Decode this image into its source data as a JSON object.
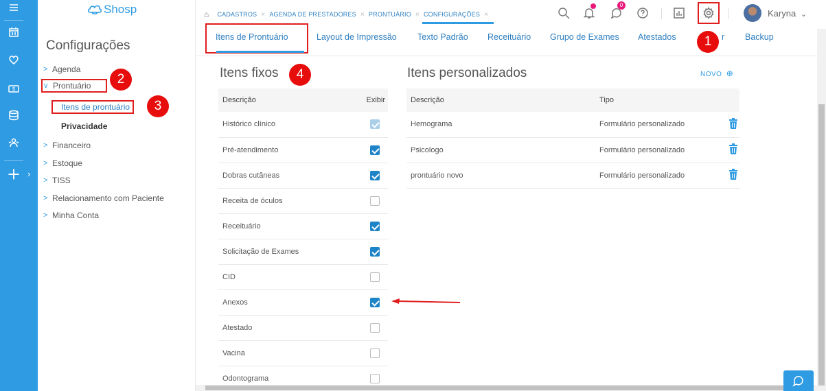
{
  "app": {
    "logo_text": "Shosp"
  },
  "rail": {
    "icons": [
      "menu-icon",
      "calendar-icon",
      "heart-icon",
      "money-icon",
      "database-icon",
      "users-icon",
      "plus-icon"
    ],
    "expand_glyph": "›"
  },
  "sidebar": {
    "title": "Configurações",
    "items": [
      {
        "label": "Agenda",
        "chevron": ">"
      },
      {
        "label": "Prontuário",
        "chevron": "v",
        "expanded": true
      },
      {
        "label": "Financeiro",
        "chevron": ">"
      },
      {
        "label": "Estoque",
        "chevron": ">"
      },
      {
        "label": "TISS",
        "chevron": ">"
      },
      {
        "label": "Relacionamento com Paciente",
        "chevron": ">"
      },
      {
        "label": "Minha Conta",
        "chevron": ">"
      }
    ],
    "sub_items": [
      {
        "label": "Itens de prontuário",
        "active": true
      },
      {
        "label": "Privacidade"
      }
    ]
  },
  "breadcrumbs": [
    "CADASTROS",
    "AGENDA DE PRESTADORES",
    "PRONTUÁRIO",
    "CONFIGURAÇÕES"
  ],
  "topbar": {
    "notification_count": "",
    "message_count": "0",
    "user_name": "Karyna",
    "user_chevron": "⌄"
  },
  "tabs": [
    "Itens de Prontuário",
    "Layout de Impressão",
    "Texto Padrão",
    "Receituário",
    "Grupo de Exames",
    "Atestados",
    "r",
    "Backup"
  ],
  "annotations": [
    "1",
    "2",
    "3",
    "4"
  ],
  "fixed_items": {
    "title": "Itens fixos",
    "headers": {
      "desc": "Descrição",
      "show": "Exibir"
    },
    "rows": [
      {
        "desc": "Histórico clínico",
        "state": "disabled-checked"
      },
      {
        "desc": "Pré-atendimento",
        "state": "checked"
      },
      {
        "desc": "Dobras cutâneas",
        "state": "checked"
      },
      {
        "desc": "Receita de óculos",
        "state": "unchecked"
      },
      {
        "desc": "Receituário",
        "state": "checked"
      },
      {
        "desc": "Solicitação de Exames",
        "state": "checked"
      },
      {
        "desc": "CID",
        "state": "unchecked"
      },
      {
        "desc": "Anexos",
        "state": "checked"
      },
      {
        "desc": "Atestado",
        "state": "unchecked"
      },
      {
        "desc": "Vacina",
        "state": "unchecked"
      },
      {
        "desc": "Odontograma",
        "state": "unchecked"
      }
    ]
  },
  "custom_items": {
    "title": "Itens personalizados",
    "new_label": "NOVO",
    "new_icon": "⊕",
    "headers": {
      "desc": "Descrição",
      "type": "Tipo"
    },
    "rows": [
      {
        "desc": "Hemograma",
        "type": "Formulário personalizado"
      },
      {
        "desc": "Psicologo",
        "type": "Formulário personalizado"
      },
      {
        "desc": "prontuário novo",
        "type": "Formulário personalizado"
      }
    ]
  },
  "colors": {
    "brand": "#2e9be3",
    "annotation_red": "#e80d0d",
    "checkbox": "#1e84c8"
  }
}
